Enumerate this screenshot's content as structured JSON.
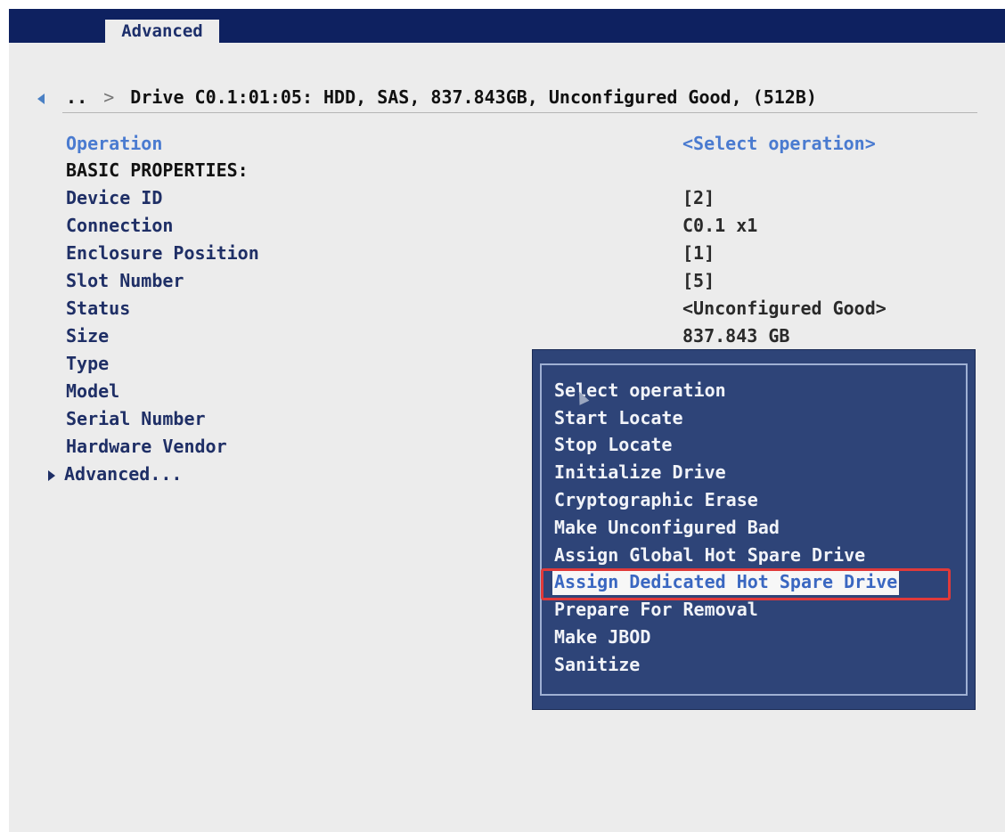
{
  "header": {
    "tab_label": "Advanced"
  },
  "breadcrumb": {
    "parent": "..",
    "separator": ">",
    "title": "Drive C0.1:01:05: HDD, SAS, 837.843GB, Unconfigured Good, (512B)"
  },
  "properties": {
    "operation_label": "Operation",
    "operation_value": "<Select operation>",
    "basic_header": "BASIC PROPERTIES:",
    "rows": [
      {
        "label": "Device ID",
        "value": "[2]"
      },
      {
        "label": "Connection",
        "value": "C0.1 x1"
      },
      {
        "label": "Enclosure Position",
        "value": "[1]"
      },
      {
        "label": "Slot Number",
        "value": "[5]"
      },
      {
        "label": "Status",
        "value": "<Unconfigured Good>"
      },
      {
        "label": "Size",
        "value": "837.843 GB"
      },
      {
        "label": "Type",
        "value": ""
      },
      {
        "label": "Model",
        "value": ""
      },
      {
        "label": "Serial Number",
        "value": ""
      },
      {
        "label": "Hardware Vendor",
        "value": ""
      }
    ],
    "advanced_link": "Advanced..."
  },
  "operation_menu": {
    "items": [
      "Select operation",
      "Start Locate",
      "Stop Locate",
      "Initialize Drive",
      "Cryptographic Erase",
      "Make Unconfigured Bad",
      "Assign Global Hot Spare Drive",
      "Assign Dedicated Hot Spare Drive",
      "Prepare For Removal",
      "Make JBOD",
      "Sanitize"
    ],
    "selected_index": 7
  },
  "colors": {
    "top_bar": "#0e2160",
    "popup_bg": "#2e4478",
    "link_blue": "#4a7bd0",
    "highlight_box": "#e03a3a"
  }
}
